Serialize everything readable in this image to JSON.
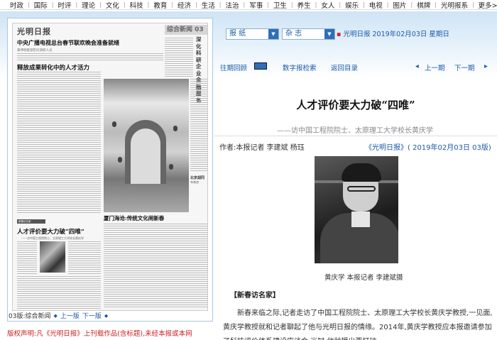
{
  "nav": {
    "items": [
      "时政",
      "国际",
      "时评",
      "理论",
      "文化",
      "科技",
      "教育",
      "经济",
      "生活",
      "法治",
      "军事",
      "卫生",
      "养生",
      "女人",
      "娱乐",
      "电视",
      "图片",
      "棋牌",
      "光明报系"
    ],
    "more": "更多>>"
  },
  "toolbar": {
    "paper_select": "报 纸",
    "magazine_select": "杂 志",
    "date_text": "光明日报 2019年02月03日 星期日",
    "past_review": "往期回顾",
    "digital_search": "数字报检索",
    "back_to_index": "返回目录",
    "prev_edition": "上一期",
    "next_edition": "下一期"
  },
  "preview": {
    "masthead": "光明日报",
    "section": "综合新闻 03",
    "headline_1": "中央广播电视总台春节联欢晚会准备就绪",
    "headline_1_sub": "黄坤明看望慰问演职人员",
    "headline_2": "释放成果转化中的人才活力",
    "vertical_title": "深化科研企业金融服务",
    "headline_3": "厦门海沧:传统文化闹新春",
    "ribbon": "新春访名家",
    "headline_4": "人才评价要大力破“四唯”",
    "headline_4_sub": "——访中国工程院院士、太原理工大学校长黄庆学",
    "caption_title": "北京胡同",
    "caption_sub": "年味浓",
    "footer_edition": "03版:综合新闻",
    "footer_prev": "上一版",
    "footer_next": "下一版"
  },
  "copyright": "版权声明:凡《光明日报》上刊载作品(含标题),未经本报或本网",
  "article": {
    "title": "人才评价要大力破“四唯”",
    "subtitle": "——访中国工程院院士、太原理工大学校长黄庆学",
    "authors": "作者:本报记者 李建斌 杨珏",
    "source": "《光明日报》( 2019年02月03日  03版)",
    "photo_caption": "黄庆学  本报记者  李建斌摄",
    "tag": "【新春访名家】",
    "paragraph": "新春来临之际,记者走访了中国工程院院士、太原理工大学校长黄庆学教授,一见面,黄庆学教授就和记者聊起了他与光明日报的情缘。2014年,黄庆学教授应本报邀请参加了科技评价体系建设座谈会,当时,他就提出要打破"
  },
  "colors": {
    "link_blue": "#1a5aa8",
    "copyright_red": "#cc2222",
    "band_light_blue": "#cfe4f5"
  }
}
